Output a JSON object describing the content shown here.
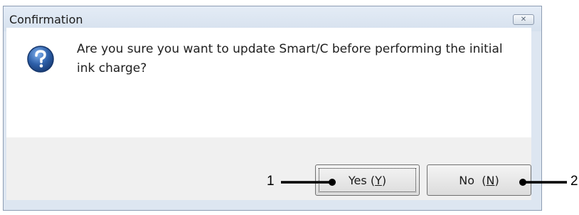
{
  "dialog": {
    "title": "Confirmation",
    "close_glyph": "✕",
    "message": "Are you sure you want to update Smart/C before performing the initial ink charge?",
    "icon": "question-icon"
  },
  "buttons": {
    "yes": {
      "label": "Yes",
      "mnemonic": "Y"
    },
    "no": {
      "label": "No",
      "mnemonic": "N"
    }
  },
  "callouts": [
    "1",
    "2"
  ],
  "colors": {
    "titlebar": "#dde6f1",
    "icon_blue": "#2d5fa8",
    "footer": "#f0f0f0"
  }
}
